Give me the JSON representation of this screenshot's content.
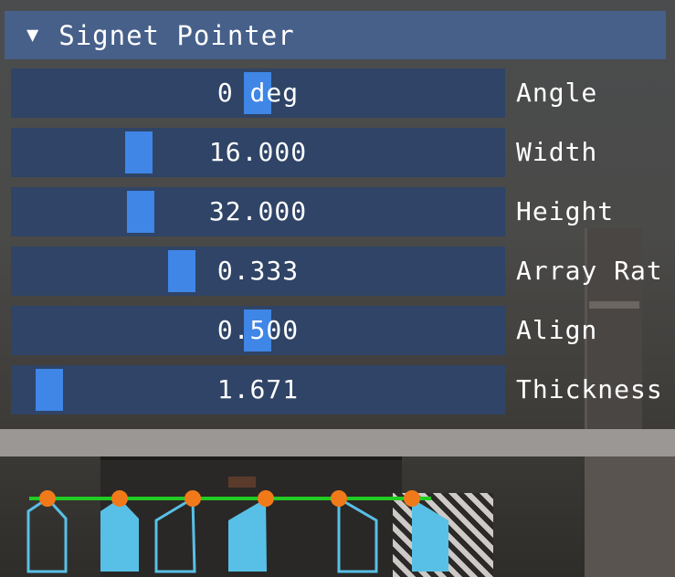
{
  "panel": {
    "title": "Signet Pointer",
    "collapse_icon": "triangle-down-icon",
    "sliders": [
      {
        "id": "angle",
        "value": "0 deg",
        "label": "Angle",
        "fraction": 0.5
      },
      {
        "id": "width",
        "value": "16.000",
        "label": "Width",
        "fraction": 0.25
      },
      {
        "id": "height",
        "value": "32.000",
        "label": "Height",
        "fraction": 0.25
      },
      {
        "id": "array-ratio",
        "value": "0.333",
        "label": "Array Rat",
        "fraction": 0.333
      },
      {
        "id": "align",
        "value": "0.500",
        "label": "Align",
        "fraction": 0.5
      },
      {
        "id": "thickness",
        "value": "1.671",
        "label": "Thickness",
        "fraction": 0.055
      }
    ]
  },
  "colors": {
    "header_bg": "#46608a",
    "frame_bg": "#2f4466",
    "grab": "#3f86e6",
    "preview_line": "#22cc22",
    "preview_dot": "#f07a1a",
    "preview_shape": "#58c0e6"
  }
}
